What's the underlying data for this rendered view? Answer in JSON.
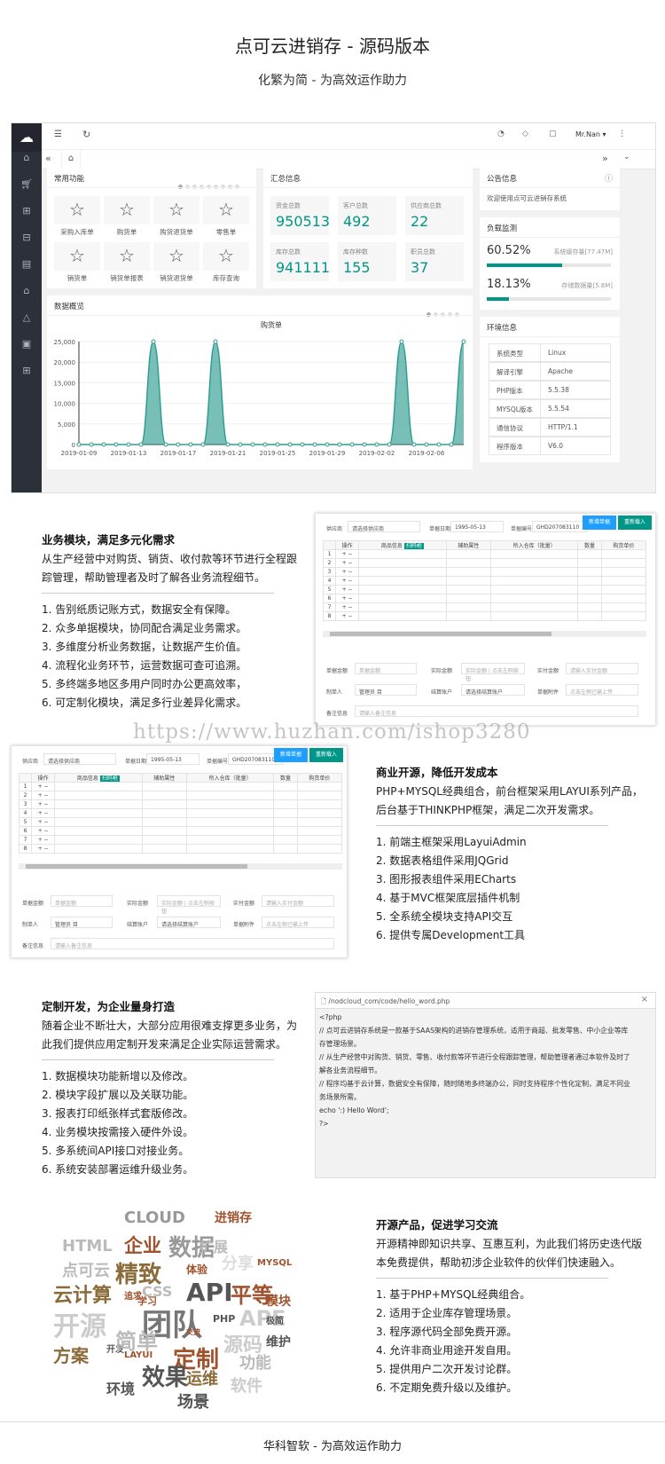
{
  "header": {
    "title": "点可云进销存 - 源码版本",
    "subtitle": "化繁为简 - 为高效运作助力"
  },
  "dashboard": {
    "topbar": {
      "user": "Mr.Nan"
    },
    "quick": {
      "title": "常用功能",
      "items": [
        "采购入库单",
        "购货单",
        "购货退货单",
        "零售单",
        "销货单",
        "销货单报表",
        "销货退货单",
        "库存查询"
      ]
    },
    "summary": {
      "title": "汇总信息",
      "stats": [
        {
          "label": "资金总数",
          "value": "950513"
        },
        {
          "label": "客户总数",
          "value": "492"
        },
        {
          "label": "供应商总数",
          "value": "22"
        },
        {
          "label": "库存总数",
          "value": "941111"
        },
        {
          "label": "库存种数",
          "value": "155"
        },
        {
          "label": "职员总数",
          "value": "37"
        }
      ]
    },
    "notice": {
      "title": "公告信息",
      "text": "欢迎使用点可云进销存系统"
    },
    "load": {
      "title": "负载监测",
      "items": [
        {
          "pct": "60.52%",
          "label": "系统缓存量[77.47M]",
          "fill": 0.6052
        },
        {
          "pct": "18.13%",
          "label": "存储数据量[5.8M]",
          "fill": 0.1813
        }
      ]
    },
    "env": {
      "title": "环境信息",
      "rows": [
        {
          "k": "系统类型",
          "v": "Linux"
        },
        {
          "k": "解译引擎",
          "v": "Apache"
        },
        {
          "k": "PHP版本",
          "v": "5.5.38"
        },
        {
          "k": "MYSQL版本",
          "v": "5.5.54"
        },
        {
          "k": "通信协议",
          "v": "HTTP/1.1"
        },
        {
          "k": "程序版本",
          "v": "V6.0"
        }
      ]
    },
    "overview": {
      "title": "数据概览"
    }
  },
  "chart_data": {
    "type": "area",
    "title": "购货单",
    "x": [
      "2019-01-09",
      "2019-01-10",
      "2019-01-11",
      "2019-01-12",
      "2019-01-13",
      "2019-01-14",
      "2019-01-15",
      "2019-01-16",
      "2019-01-17",
      "2019-01-18",
      "2019-01-19",
      "2019-01-20",
      "2019-01-21",
      "2019-01-22",
      "2019-01-23",
      "2019-01-24",
      "2019-01-25",
      "2019-01-26",
      "2019-01-27",
      "2019-01-28",
      "2019-01-29",
      "2019-01-30",
      "2019-01-31",
      "2019-02-01",
      "2019-02-02",
      "2019-02-03",
      "2019-02-04",
      "2019-02-05",
      "2019-02-06",
      "2019-02-07"
    ],
    "values": [
      0,
      0,
      0,
      0,
      0,
      0,
      25000,
      0,
      0,
      0,
      0,
      25000,
      0,
      0,
      0,
      0,
      0,
      0,
      0,
      0,
      0,
      0,
      0,
      0,
      0,
      0,
      25000,
      0,
      0,
      0,
      0,
      25000
    ],
    "ylim": [
      0,
      25000
    ],
    "yticks": [
      "0",
      "5,000",
      "10,000",
      "15,000",
      "20,000",
      "25,000"
    ],
    "xticks": [
      "2019-01-09",
      "2019-01-13",
      "2019-01-17",
      "2019-01-21",
      "2019-01-25",
      "2019-01-29",
      "2019-02-02",
      "2019-02-06"
    ],
    "color": "#2f9e91"
  },
  "feature1": {
    "title": "业务模块，满足多元化需求",
    "desc": "从生产经营中对购货、销货、收付款等环节进行全程跟踪管理，帮助管理者及时了解各业务流程细节。",
    "list": [
      "1. 告别纸质记账方式，数据安全有保障。",
      "2. 众多单据模块，协同配合满足业务需求。",
      "3. 多维度分析业务数据，让数据产生价值。",
      "4. 流程化业务环节，运营数据可查可追溯。",
      "5. 多终端多地区多用户同时办公更高效率，",
      "6. 可定制化模块，满足多行业差异化需求。"
    ]
  },
  "form": {
    "supplier_label": "供应商",
    "supplier_placeholder": "请选择供应商",
    "date_label": "单据日期",
    "date_value": "1995-05-13",
    "no_label": "单据编号",
    "no_value": "GHD207083110",
    "btn_new": "新增单据",
    "btn_reload": "重新载入",
    "cols": [
      "操作",
      "商品信息",
      "辅助属性",
      "所入仓库（批量）",
      "数量",
      "购货单价"
    ],
    "tag": "扫码枪",
    "op": "+ −",
    "f1": "单据金额",
    "f1p": "单据金额",
    "f2": "实际金额",
    "f2p": "实际金额 | 点击左侧按钮",
    "f3": "实付金额",
    "f3p": "请输入实付金额",
    "f4": "制单人",
    "f4p": "管理员 目",
    "f5": "结算账户",
    "f5p": "请选择结算账户",
    "f6": "单据附件",
    "f6p": "点击左侧已输上传",
    "f7": "备注信息",
    "f7p": "请输入备注信息"
  },
  "watermark": "https://www.huzhan.com/ishop3280",
  "feature2": {
    "title": "商业开源，降低开发成本",
    "desc": "PHP+MYSQL经典组合，前台框架采用LAYUI系列产品，后台基于THINKPHP框架，满足二次开发需求。",
    "list": [
      "1. 前端主框架采用LayuiAdmin",
      "2. 数据表格组件采用JQGrid",
      "3. 图形报表组件采用ECharts",
      "4. 基于MVC框架底层插件机制",
      "5. 全系统全模块支持API交互",
      "6. 提供专属Development工具"
    ]
  },
  "feature3": {
    "title": "定制开发，为企业量身打造",
    "desc": "随着企业不断壮大，大部分应用很难支撑更多业务，为此我们提供应用定制开发来满足企业实际运营需求。",
    "list": [
      "1. 数据模块功能新增以及修改。",
      "2. 模块字段扩展以及关联功能。",
      "3. 报表打印纸张样式套版修改。",
      "4. 业务模块按需接入硬件外设。",
      "5. 多系统间API接口对接业务。",
      "6. 系统安装部署运维升级业务。"
    ]
  },
  "code": {
    "path": "/nodcloud_com/code/hello_word.php",
    "lines": [
      "<?php",
      "    // 点可云进销存系统是一款基于SAAS架构的进销存管理系统，适用于商超、批发零售、中小企业等库",
      "存管理场景。",
      "    // 从生产经营中对购货、销货、零售、收付款等环节进行全程跟踪管理，帮助管理者通过本软件及时了",
      "解各业务流程细节。",
      "    // 程序均基于云计算，数据安全有保障，随时随地多终端办公，同时支持程序个性化定制，满足不同业",
      "务场景所需。",
      "    echo ':) Hello Word';",
      "?>"
    ]
  },
  "feature4": {
    "title": "开源产品，促进学习交流",
    "desc": "开源精神即知识共享、互惠互利，为此我们将历史迭代版本免费提供，帮助初涉企业软件的伙伴们快速融入。",
    "list": [
      "1. 基于PHP+MYSQL经典组合。",
      "2. 适用于企业库存管理场景。",
      "3. 程序源代码全部免费开源。",
      "4. 允许非商业用途开发自用。",
      "5. 提供用户二次开发讨论群。",
      "6. 不定期免费升级以及维护。"
    ]
  },
  "cloud": [
    "CLOUD",
    "企业",
    "HTML",
    "点可云",
    "精致",
    "数据",
    "体验",
    "扩展",
    "进销存",
    "分享",
    "MYSQL",
    "云计算",
    "开源",
    "团队",
    "API",
    "平等",
    "模块",
    "学习",
    "CSS",
    "追求",
    "PHP",
    "APE",
    "极简",
    "方案",
    "定制",
    "维护",
    "交流",
    "源码",
    "功能",
    "效果",
    "运维",
    "软件",
    "环境",
    "场景",
    "开发",
    "LAYUI",
    "简单"
  ],
  "footer": "华科智软 - 为高效运作助力"
}
